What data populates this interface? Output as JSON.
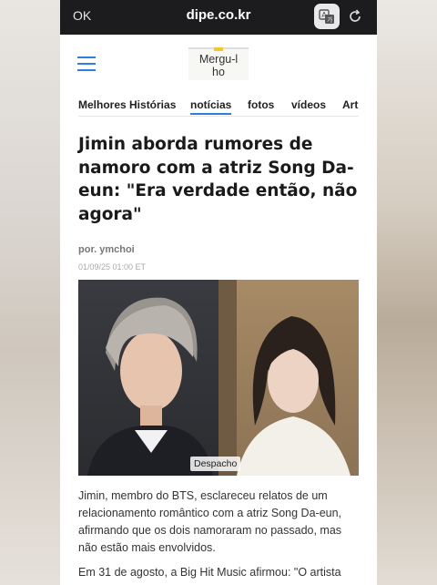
{
  "browser": {
    "done_label": "OK",
    "url": "dipe.co.kr"
  },
  "site": {
    "logo_text": "Mergu-lho"
  },
  "nav": {
    "items": [
      {
        "label": "Melhores Histórias"
      },
      {
        "label": "notícias"
      },
      {
        "label": "fotos"
      },
      {
        "label": "vídeos"
      },
      {
        "label": "Art"
      }
    ],
    "active": "notícias"
  },
  "article": {
    "title": "Jimin aborda rumores de namoro com a atriz Song Da-eun: \"Era verdade então, não agora\"",
    "author": "por. ymchoi",
    "date": "01/09/25 01:00 ET",
    "image_caption": "Despacho",
    "paragraphs": [
      "Jimin, membro do BTS, esclareceu relatos de um relacionamento romântico com a atriz Song Da-eun, afirmando que os dois namoraram no passado, mas não estão mais envolvidos.",
      "Em 31 de agosto, a Big Hit Music afirmou: \"O artista"
    ]
  },
  "colors": {
    "accent": "#2f7fe0",
    "topbar": "#1c1c1e"
  }
}
